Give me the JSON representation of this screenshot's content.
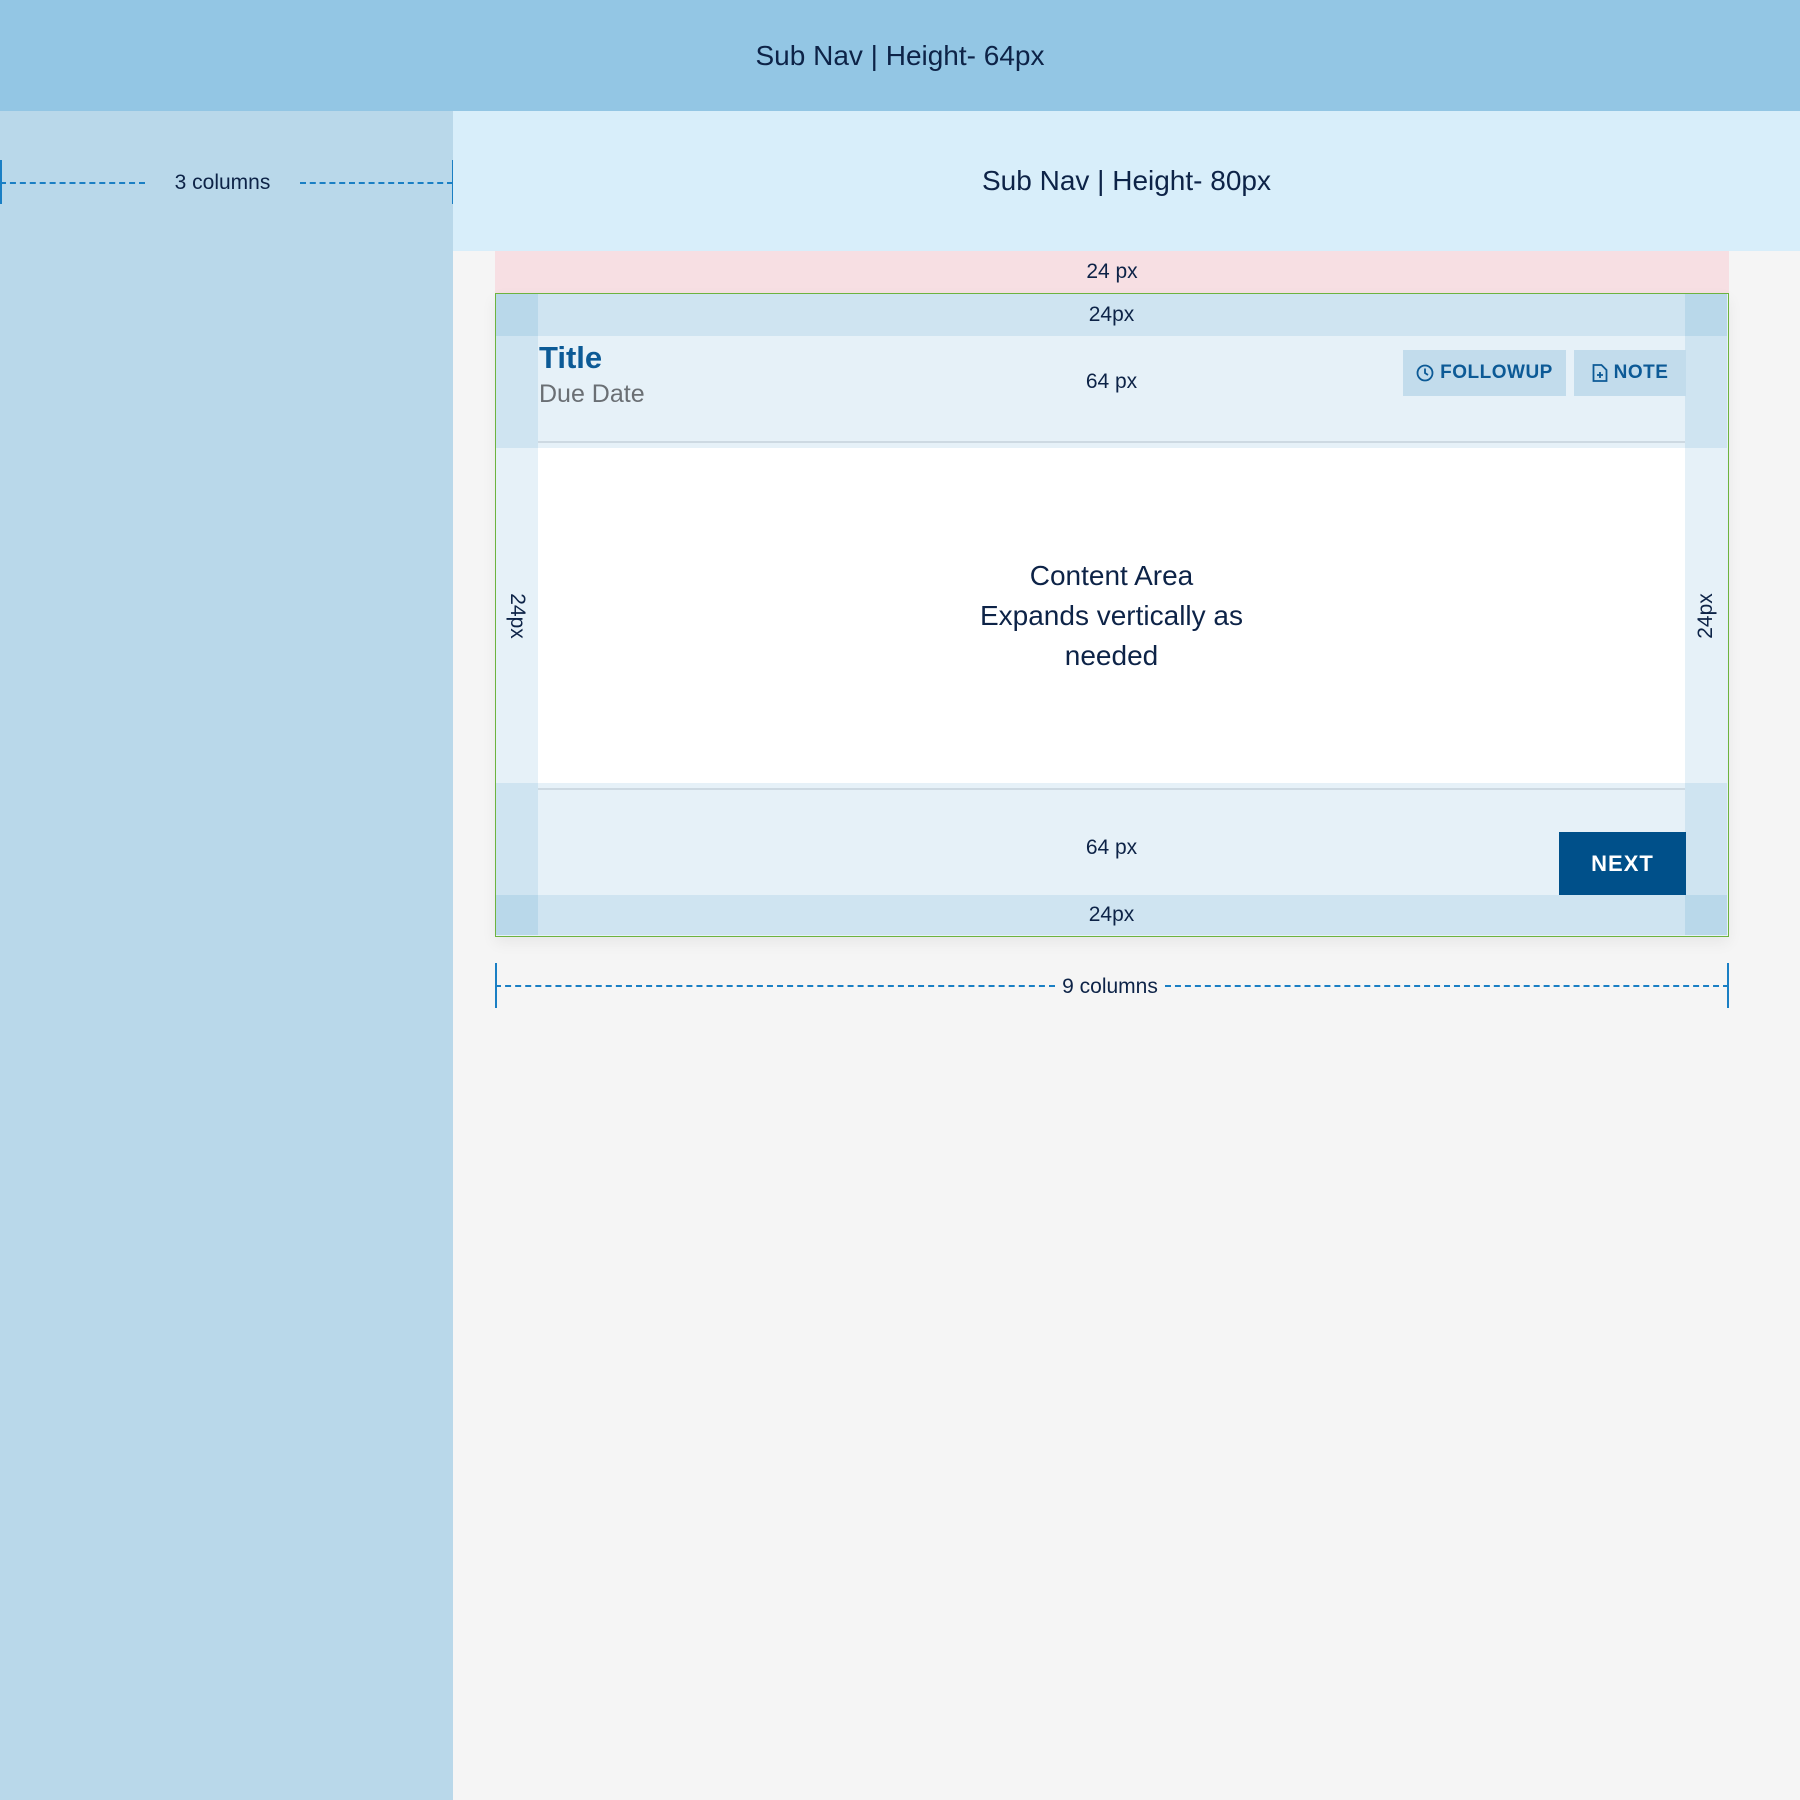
{
  "top_nav": {
    "label": "Sub Nav | Height- 64px"
  },
  "sidebar": {
    "dimension_label": "3 columns"
  },
  "sub_nav": {
    "label": "Sub Nav | Height- 80px"
  },
  "spacing": {
    "top_margin": "24 px",
    "card_top_padding": "24px",
    "header_height": "64 px",
    "left_padding": "24px",
    "right_padding": "24px",
    "footer_height": "64 px",
    "card_bottom_padding": "24px"
  },
  "card": {
    "title": "Title",
    "subtitle": "Due Date",
    "followup_label": "FOLLOWUP",
    "note_label": "NOTE",
    "content_lines": [
      "Content Area",
      "Expands vertically as",
      "needed"
    ],
    "next_label": "NEXT"
  },
  "main": {
    "dimension_label": "9 columns"
  }
}
